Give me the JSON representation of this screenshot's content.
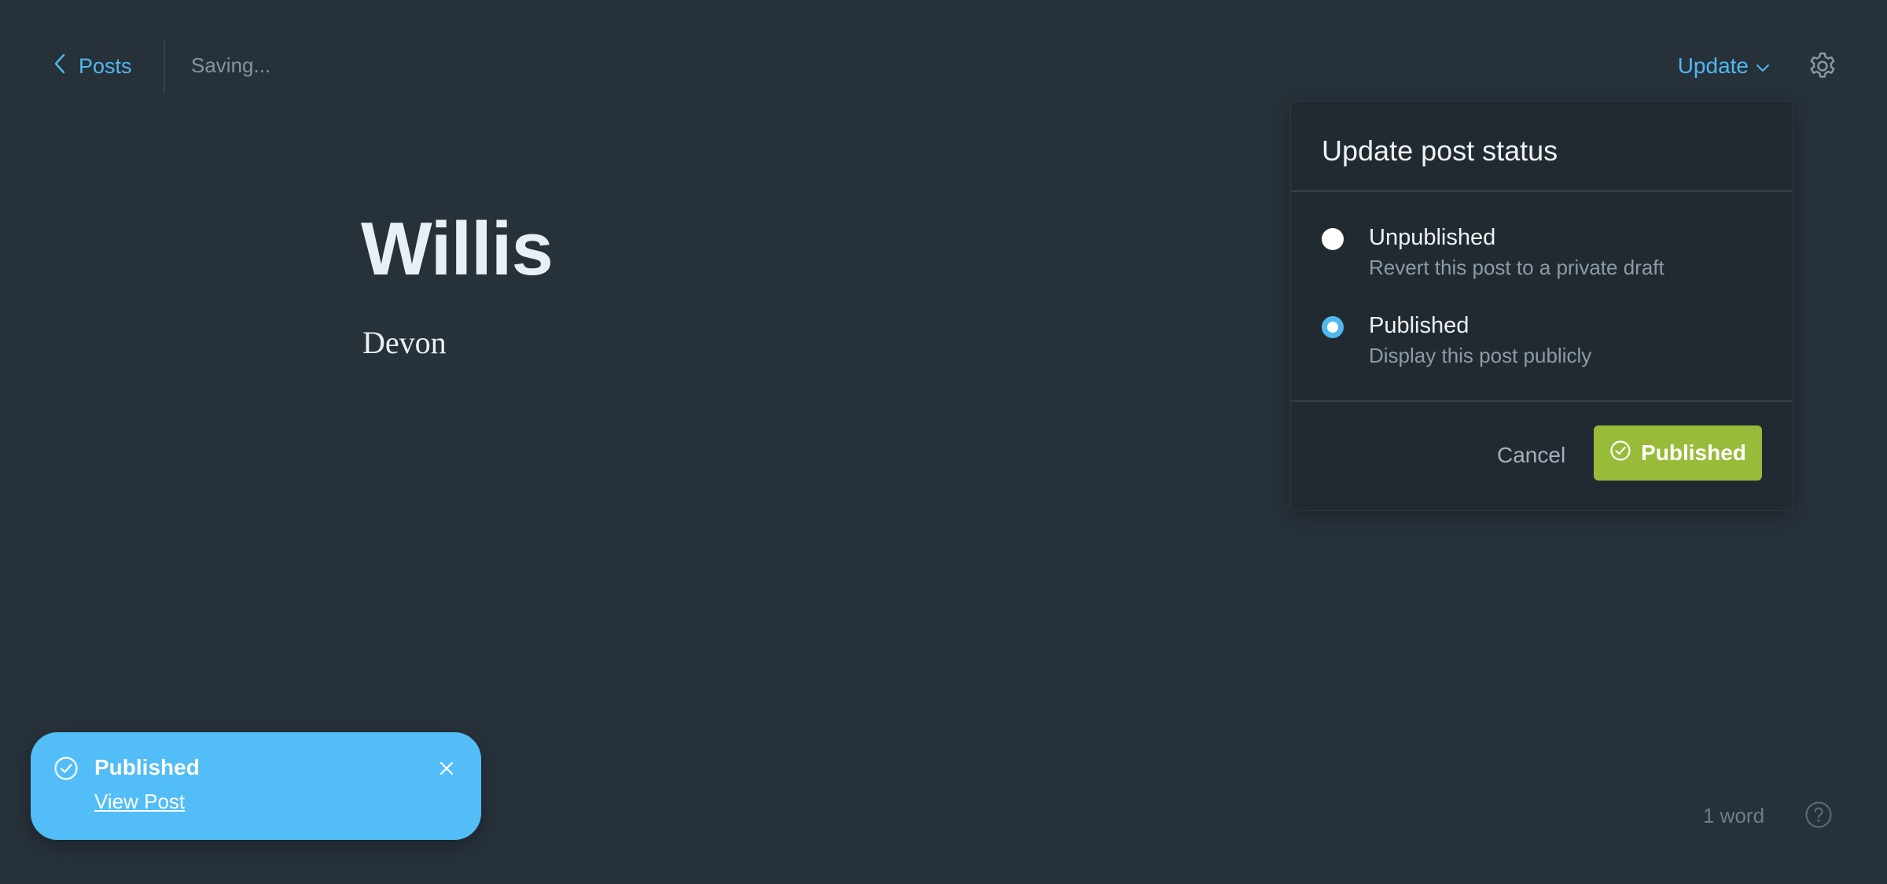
{
  "header": {
    "back_label": "Posts",
    "status_text": "Saving...",
    "update_label": "Update"
  },
  "editor": {
    "title": "Willis",
    "body": "Devon"
  },
  "status_panel": {
    "heading": "Update post status",
    "options": [
      {
        "label": "Unpublished",
        "description": "Revert this post to a private draft",
        "selected": false
      },
      {
        "label": "Published",
        "description": "Display this post publicly",
        "selected": true
      }
    ],
    "cancel_label": "Cancel",
    "confirm_label": "Published"
  },
  "toast": {
    "title": "Published",
    "link_label": "View Post"
  },
  "footer": {
    "word_count": "1 word"
  },
  "colors": {
    "background": "#27313a",
    "accent": "#4fb8ee",
    "publish_green": "#98bb3a",
    "toast_blue": "#52bdf7"
  },
  "icons": [
    "chevron-left-icon",
    "chevron-down-icon",
    "gear-icon",
    "check-circle-icon",
    "close-icon",
    "help-icon"
  ]
}
